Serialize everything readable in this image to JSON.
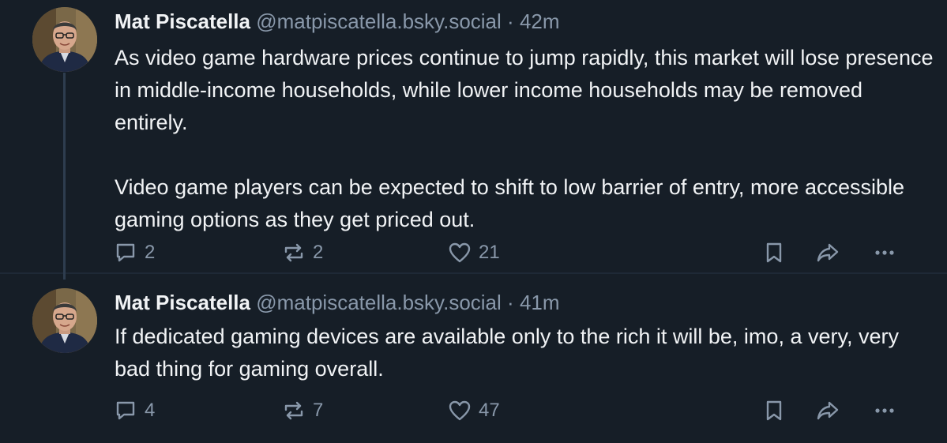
{
  "posts": [
    {
      "author_name": "Mat Piscatella",
      "handle": "@matpiscatella.bsky.social",
      "separator": "·",
      "time": "42m",
      "text": "As video game hardware prices continue to jump rapidly, this market will lose presence in middle-income households, while lower income households may be removed entirely.\n\nVideo game players can be expected to shift to low barrier of entry, more accessible gaming options as they get priced out.",
      "replies": "2",
      "reposts": "2",
      "likes": "21"
    },
    {
      "author_name": "Mat Piscatella",
      "handle": "@matpiscatella.bsky.social",
      "separator": "·",
      "time": "41m",
      "text": "If dedicated gaming devices are available only to the rich it will be, imo, a very, very bad thing for gaming overall.",
      "replies": "4",
      "reposts": "7",
      "likes": "47"
    }
  ],
  "icons": {
    "reply": "reply-icon",
    "repost": "repost-icon",
    "like": "heart-icon",
    "bookmark": "bookmark-icon",
    "share": "share-icon",
    "more": "more-icon"
  },
  "colors": {
    "background": "#161e27",
    "text": "#f1f3f5",
    "muted": "#8998aa",
    "thread_line": "#2e3d4f"
  }
}
